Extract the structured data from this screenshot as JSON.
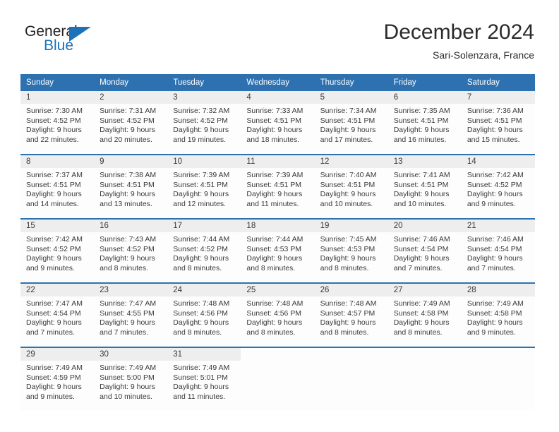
{
  "brand": {
    "name_top": "General",
    "name_bottom": "Blue",
    "accent_color": "#1b72b8"
  },
  "header": {
    "title": "December 2024",
    "location": "Sari-Solenzara, France"
  },
  "theme": {
    "header_blue": "#2e71b0",
    "daynum_band": "#eeeeee",
    "text": "#3a3a3a"
  },
  "calendar": {
    "weekday_headers": [
      "Sunday",
      "Monday",
      "Tuesday",
      "Wednesday",
      "Thursday",
      "Friday",
      "Saturday"
    ],
    "weeks": [
      [
        {
          "day": "1",
          "sunrise": "Sunrise: 7:30 AM",
          "sunset": "Sunset: 4:52 PM",
          "daylight1": "Daylight: 9 hours",
          "daylight2": "and 22 minutes."
        },
        {
          "day": "2",
          "sunrise": "Sunrise: 7:31 AM",
          "sunset": "Sunset: 4:52 PM",
          "daylight1": "Daylight: 9 hours",
          "daylight2": "and 20 minutes."
        },
        {
          "day": "3",
          "sunrise": "Sunrise: 7:32 AM",
          "sunset": "Sunset: 4:52 PM",
          "daylight1": "Daylight: 9 hours",
          "daylight2": "and 19 minutes."
        },
        {
          "day": "4",
          "sunrise": "Sunrise: 7:33 AM",
          "sunset": "Sunset: 4:51 PM",
          "daylight1": "Daylight: 9 hours",
          "daylight2": "and 18 minutes."
        },
        {
          "day": "5",
          "sunrise": "Sunrise: 7:34 AM",
          "sunset": "Sunset: 4:51 PM",
          "daylight1": "Daylight: 9 hours",
          "daylight2": "and 17 minutes."
        },
        {
          "day": "6",
          "sunrise": "Sunrise: 7:35 AM",
          "sunset": "Sunset: 4:51 PM",
          "daylight1": "Daylight: 9 hours",
          "daylight2": "and 16 minutes."
        },
        {
          "day": "7",
          "sunrise": "Sunrise: 7:36 AM",
          "sunset": "Sunset: 4:51 PM",
          "daylight1": "Daylight: 9 hours",
          "daylight2": "and 15 minutes."
        }
      ],
      [
        {
          "day": "8",
          "sunrise": "Sunrise: 7:37 AM",
          "sunset": "Sunset: 4:51 PM",
          "daylight1": "Daylight: 9 hours",
          "daylight2": "and 14 minutes."
        },
        {
          "day": "9",
          "sunrise": "Sunrise: 7:38 AM",
          "sunset": "Sunset: 4:51 PM",
          "daylight1": "Daylight: 9 hours",
          "daylight2": "and 13 minutes."
        },
        {
          "day": "10",
          "sunrise": "Sunrise: 7:39 AM",
          "sunset": "Sunset: 4:51 PM",
          "daylight1": "Daylight: 9 hours",
          "daylight2": "and 12 minutes."
        },
        {
          "day": "11",
          "sunrise": "Sunrise: 7:39 AM",
          "sunset": "Sunset: 4:51 PM",
          "daylight1": "Daylight: 9 hours",
          "daylight2": "and 11 minutes."
        },
        {
          "day": "12",
          "sunrise": "Sunrise: 7:40 AM",
          "sunset": "Sunset: 4:51 PM",
          "daylight1": "Daylight: 9 hours",
          "daylight2": "and 10 minutes."
        },
        {
          "day": "13",
          "sunrise": "Sunrise: 7:41 AM",
          "sunset": "Sunset: 4:51 PM",
          "daylight1": "Daylight: 9 hours",
          "daylight2": "and 10 minutes."
        },
        {
          "day": "14",
          "sunrise": "Sunrise: 7:42 AM",
          "sunset": "Sunset: 4:52 PM",
          "daylight1": "Daylight: 9 hours",
          "daylight2": "and 9 minutes."
        }
      ],
      [
        {
          "day": "15",
          "sunrise": "Sunrise: 7:42 AM",
          "sunset": "Sunset: 4:52 PM",
          "daylight1": "Daylight: 9 hours",
          "daylight2": "and 9 minutes."
        },
        {
          "day": "16",
          "sunrise": "Sunrise: 7:43 AM",
          "sunset": "Sunset: 4:52 PM",
          "daylight1": "Daylight: 9 hours",
          "daylight2": "and 8 minutes."
        },
        {
          "day": "17",
          "sunrise": "Sunrise: 7:44 AM",
          "sunset": "Sunset: 4:52 PM",
          "daylight1": "Daylight: 9 hours",
          "daylight2": "and 8 minutes."
        },
        {
          "day": "18",
          "sunrise": "Sunrise: 7:44 AM",
          "sunset": "Sunset: 4:53 PM",
          "daylight1": "Daylight: 9 hours",
          "daylight2": "and 8 minutes."
        },
        {
          "day": "19",
          "sunrise": "Sunrise: 7:45 AM",
          "sunset": "Sunset: 4:53 PM",
          "daylight1": "Daylight: 9 hours",
          "daylight2": "and 8 minutes."
        },
        {
          "day": "20",
          "sunrise": "Sunrise: 7:46 AM",
          "sunset": "Sunset: 4:54 PM",
          "daylight1": "Daylight: 9 hours",
          "daylight2": "and 7 minutes."
        },
        {
          "day": "21",
          "sunrise": "Sunrise: 7:46 AM",
          "sunset": "Sunset: 4:54 PM",
          "daylight1": "Daylight: 9 hours",
          "daylight2": "and 7 minutes."
        }
      ],
      [
        {
          "day": "22",
          "sunrise": "Sunrise: 7:47 AM",
          "sunset": "Sunset: 4:54 PM",
          "daylight1": "Daylight: 9 hours",
          "daylight2": "and 7 minutes."
        },
        {
          "day": "23",
          "sunrise": "Sunrise: 7:47 AM",
          "sunset": "Sunset: 4:55 PM",
          "daylight1": "Daylight: 9 hours",
          "daylight2": "and 7 minutes."
        },
        {
          "day": "24",
          "sunrise": "Sunrise: 7:48 AM",
          "sunset": "Sunset: 4:56 PM",
          "daylight1": "Daylight: 9 hours",
          "daylight2": "and 8 minutes."
        },
        {
          "day": "25",
          "sunrise": "Sunrise: 7:48 AM",
          "sunset": "Sunset: 4:56 PM",
          "daylight1": "Daylight: 9 hours",
          "daylight2": "and 8 minutes."
        },
        {
          "day": "26",
          "sunrise": "Sunrise: 7:48 AM",
          "sunset": "Sunset: 4:57 PM",
          "daylight1": "Daylight: 9 hours",
          "daylight2": "and 8 minutes."
        },
        {
          "day": "27",
          "sunrise": "Sunrise: 7:49 AM",
          "sunset": "Sunset: 4:58 PM",
          "daylight1": "Daylight: 9 hours",
          "daylight2": "and 8 minutes."
        },
        {
          "day": "28",
          "sunrise": "Sunrise: 7:49 AM",
          "sunset": "Sunset: 4:58 PM",
          "daylight1": "Daylight: 9 hours",
          "daylight2": "and 9 minutes."
        }
      ],
      [
        {
          "day": "29",
          "sunrise": "Sunrise: 7:49 AM",
          "sunset": "Sunset: 4:59 PM",
          "daylight1": "Daylight: 9 hours",
          "daylight2": "and 9 minutes."
        },
        {
          "day": "30",
          "sunrise": "Sunrise: 7:49 AM",
          "sunset": "Sunset: 5:00 PM",
          "daylight1": "Daylight: 9 hours",
          "daylight2": "and 10 minutes."
        },
        {
          "day": "31",
          "sunrise": "Sunrise: 7:49 AM",
          "sunset": "Sunset: 5:01 PM",
          "daylight1": "Daylight: 9 hours",
          "daylight2": "and 11 minutes."
        },
        {
          "day": "",
          "sunrise": "",
          "sunset": "",
          "daylight1": "",
          "daylight2": ""
        },
        {
          "day": "",
          "sunrise": "",
          "sunset": "",
          "daylight1": "",
          "daylight2": ""
        },
        {
          "day": "",
          "sunrise": "",
          "sunset": "",
          "daylight1": "",
          "daylight2": ""
        },
        {
          "day": "",
          "sunrise": "",
          "sunset": "",
          "daylight1": "",
          "daylight2": ""
        }
      ]
    ]
  }
}
